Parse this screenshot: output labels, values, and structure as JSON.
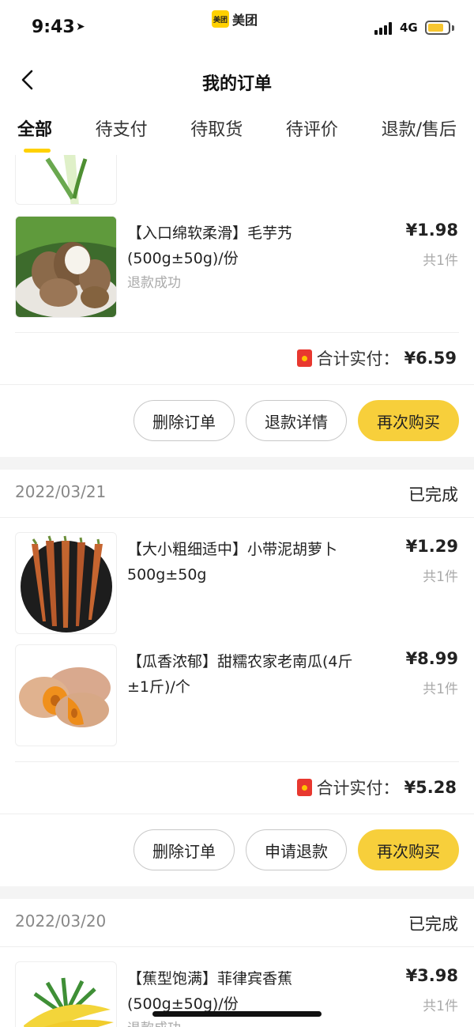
{
  "status_bar": {
    "time": "9:43",
    "app_logo_text": "美团",
    "app_name": "美团",
    "network": "4G",
    "battery_level": 0.8
  },
  "nav": {
    "title": "我的订单"
  },
  "tabs": [
    {
      "label": "全部",
      "active": true
    },
    {
      "label": "待支付"
    },
    {
      "label": "待取货"
    },
    {
      "label": "待评价"
    },
    {
      "label": "退款/售后"
    }
  ],
  "orders": [
    {
      "items": [
        {
          "name": "【入口绵软柔滑】毛芋艿(500g±50g)/份",
          "price": "¥1.98",
          "qty": "共1件",
          "status": "退款成功"
        }
      ],
      "total_label": "合计实付：",
      "total_value": "¥6.59",
      "actions": [
        "删除订单",
        "退款详情",
        "再次购买"
      ]
    },
    {
      "date": "2022/03/21",
      "state": "已完成",
      "items": [
        {
          "name": "【大小粗细适中】小带泥胡萝卜500g±50g",
          "price": "¥1.29",
          "qty": "共1件"
        },
        {
          "name": "【瓜香浓郁】甜糯农家老南瓜(4斤±1斤)/个",
          "price": "¥8.99",
          "qty": "共1件"
        }
      ],
      "total_label": "合计实付：",
      "total_value": "¥5.28",
      "actions": [
        "删除订单",
        "申请退款",
        "再次购买"
      ]
    },
    {
      "date": "2022/03/20",
      "state": "已完成",
      "items": [
        {
          "name": "【蕉型饱满】菲律宾香蕉(500g±50g)/份",
          "price": "¥3.98",
          "qty": "共1件",
          "status": "退款成功"
        }
      ]
    }
  ],
  "colors": {
    "accent": "#f7cf3b",
    "tab_underline": "#ffd100",
    "muted": "#aaaaaa"
  }
}
